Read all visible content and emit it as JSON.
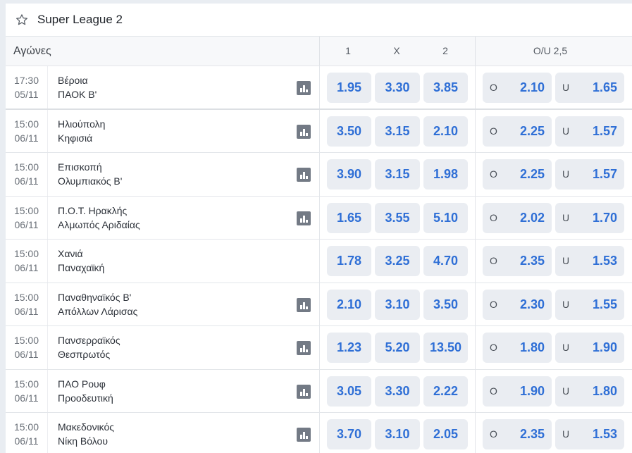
{
  "league": {
    "title": "Super League 2",
    "favorite_icon": "star-outline-icon"
  },
  "columns": {
    "matches": "Αγώνες",
    "home": "1",
    "draw": "X",
    "away": "2",
    "over_under": "O/U 2,5"
  },
  "matches": [
    {
      "time": "17:30",
      "date": "05/11",
      "home": "Βέροια",
      "away": "ΠΑΟΚ Β'",
      "stats": true,
      "odds": [
        "1.95",
        "3.30",
        "3.85"
      ],
      "over_label": "O",
      "over": "2.10",
      "under_label": "U",
      "under": "1.65"
    },
    {
      "time": "15:00",
      "date": "06/11",
      "home": "Ηλιούπολη",
      "away": "Κηφισιά",
      "stats": true,
      "odds": [
        "3.50",
        "3.15",
        "2.10"
      ],
      "over_label": "O",
      "over": "2.25",
      "under_label": "U",
      "under": "1.57"
    },
    {
      "time": "15:00",
      "date": "06/11",
      "home": "Επισκοπή",
      "away": "Ολυμπιακός Β'",
      "stats": true,
      "odds": [
        "3.90",
        "3.15",
        "1.98"
      ],
      "over_label": "O",
      "over": "2.25",
      "under_label": "U",
      "under": "1.57"
    },
    {
      "time": "15:00",
      "date": "06/11",
      "home": "Π.Ο.Τ. Ηρακλής",
      "away": "Αλμωπός Αριδαίας",
      "stats": true,
      "odds": [
        "1.65",
        "3.55",
        "5.10"
      ],
      "over_label": "O",
      "over": "2.02",
      "under_label": "U",
      "under": "1.70"
    },
    {
      "time": "15:00",
      "date": "06/11",
      "home": "Χανιά",
      "away": "Παναχαϊκή",
      "stats": false,
      "odds": [
        "1.78",
        "3.25",
        "4.70"
      ],
      "over_label": "O",
      "over": "2.35",
      "under_label": "U",
      "under": "1.53"
    },
    {
      "time": "15:00",
      "date": "06/11",
      "home": "Παναθηναϊκός Β'",
      "away": "Απόλλων Λάρισας",
      "stats": true,
      "odds": [
        "2.10",
        "3.10",
        "3.50"
      ],
      "over_label": "O",
      "over": "2.30",
      "under_label": "U",
      "under": "1.55"
    },
    {
      "time": "15:00",
      "date": "06/11",
      "home": "Πανσερραϊκός",
      "away": "Θεσπρωτός",
      "stats": true,
      "odds": [
        "1.23",
        "5.20",
        "13.50"
      ],
      "over_label": "O",
      "over": "1.80",
      "under_label": "U",
      "under": "1.90"
    },
    {
      "time": "15:00",
      "date": "06/11",
      "home": "ΠΑΟ Ρουφ",
      "away": "Προοδευτική",
      "stats": true,
      "odds": [
        "3.05",
        "3.30",
        "2.22"
      ],
      "over_label": "O",
      "over": "1.90",
      "under_label": "U",
      "under": "1.80"
    },
    {
      "time": "15:00",
      "date": "06/11",
      "home": "Μακεδονικός",
      "away": "Νίκη Βόλου",
      "stats": true,
      "odds": [
        "3.70",
        "3.10",
        "2.05"
      ],
      "over_label": "O",
      "over": "2.35",
      "under_label": "U",
      "under": "1.53"
    }
  ],
  "colors": {
    "odds_text": "#2f6fd6",
    "odds_bg": "#eaedf2",
    "stats_icon": "#737a85"
  }
}
